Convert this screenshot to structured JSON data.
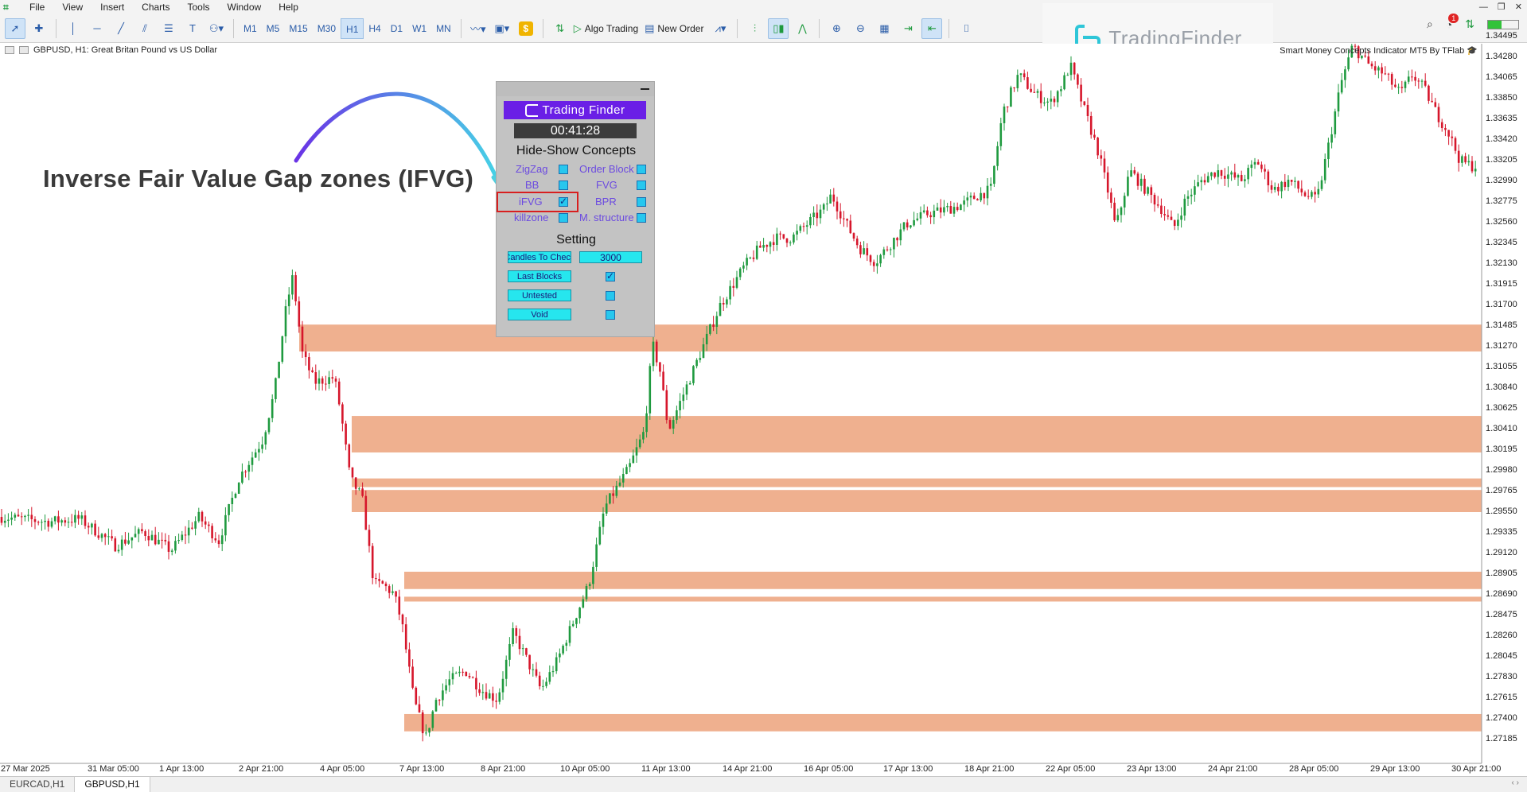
{
  "menu": [
    "File",
    "View",
    "Insert",
    "Charts",
    "Tools",
    "Window",
    "Help"
  ],
  "toolbar": {
    "timeframes": [
      "M1",
      "M5",
      "M15",
      "M30",
      "H1",
      "H4",
      "D1",
      "W1",
      "MN"
    ],
    "active_timeframe": "H1",
    "algo_trading": "Algo Trading",
    "new_order": "New Order"
  },
  "notification_count": "1",
  "logo_text": "TradingFinder",
  "chart": {
    "symbol_line": "GBPUSD, H1:  Great Britan Pound vs US Dollar",
    "indicator_name": "Smart Money Concepts Indicator MT5 By TFlab"
  },
  "annotation": "Inverse Fair Value Gap zones (IFVG)",
  "panel": {
    "brand": "Trading Finder",
    "timer": "00:41:28",
    "section1": "Hide-Show Concepts",
    "concepts": [
      {
        "label": "ZigZag",
        "checked": false
      },
      {
        "label": "Order Block",
        "checked": false
      },
      {
        "label": "BB",
        "checked": false
      },
      {
        "label": "FVG",
        "checked": false
      },
      {
        "label": "iFVG",
        "checked": true
      },
      {
        "label": "BPR",
        "checked": false
      },
      {
        "label": "killzone",
        "checked": false
      },
      {
        "label": "M. structure",
        "checked": false
      }
    ],
    "section2": "Setting",
    "settings": [
      {
        "label": "Candles To Check",
        "value": "3000"
      },
      {
        "label": "Last Blocks",
        "checked": true
      },
      {
        "label": "Untested",
        "checked": false
      },
      {
        "label": "Void",
        "checked": false
      }
    ]
  },
  "price_axis": [
    "1.34495",
    "1.34280",
    "1.34065",
    "1.33850",
    "1.33635",
    "1.33420",
    "1.33205",
    "1.32990",
    "1.32775",
    "1.32560",
    "1.32345",
    "1.32130",
    "1.31915",
    "1.31700",
    "1.31485",
    "1.31270",
    "1.31055",
    "1.30840",
    "1.30625",
    "1.30410",
    "1.30195",
    "1.29980",
    "1.29765",
    "1.29550",
    "1.29335",
    "1.29120",
    "1.28905",
    "1.28690",
    "1.28475",
    "1.28260",
    "1.28045",
    "1.27830",
    "1.27615",
    "1.27400",
    "1.27185"
  ],
  "time_axis": [
    "27 Mar 2025",
    "31 Mar 05:00",
    "1 Apr 13:00",
    "2 Apr 21:00",
    "4 Apr 05:00",
    "7 Apr 13:00",
    "8 Apr 21:00",
    "10 Apr 05:00",
    "11 Apr 13:00",
    "14 Apr 21:00",
    "16 Apr 05:00",
    "17 Apr 13:00",
    "18 Apr 21:00",
    "22 Apr 05:00",
    "23 Apr 13:00",
    "24 Apr 21:00",
    "28 Apr 05:00",
    "29 Apr 13:00",
    "30 Apr 21:00"
  ],
  "ifvg_zones": [
    {
      "from_time": "2 Apr 21:00",
      "top": 1.315,
      "bottom": 1.3122
    },
    {
      "from_time": "4 Apr 05:00",
      "top": 1.3055,
      "bottom": 1.3017
    },
    {
      "from_time": "4 Apr 05:00",
      "top": 1.299,
      "bottom": 1.2981
    },
    {
      "from_time": "4 Apr 05:00",
      "top": 1.2978,
      "bottom": 1.2955
    },
    {
      "from_time": "7 Apr 13:00",
      "top": 1.2893,
      "bottom": 1.2875
    },
    {
      "from_time": "7 Apr 13:00",
      "top": 1.2867,
      "bottom": 1.2862
    },
    {
      "from_time": "7 Apr 13:00",
      "top": 1.2745,
      "bottom": 1.2727
    }
  ],
  "colors": {
    "zone": "#efb08f",
    "bull": "#1f9a3f",
    "bear": "#d6162b",
    "panel_accent": "#6a1fe6"
  },
  "tabs": [
    "EURCAD,H1",
    "GBPUSD,H1"
  ],
  "active_tab": "GBPUSD,H1"
}
